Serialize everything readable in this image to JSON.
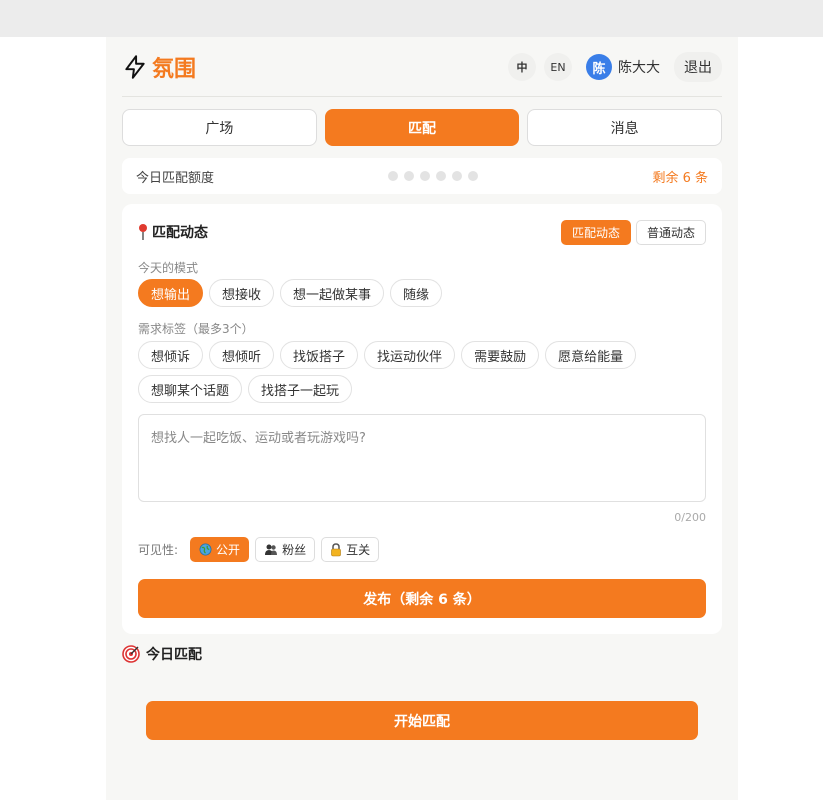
{
  "app": {
    "logo_text": "氛围",
    "lang_zh": "中",
    "lang_en": "EN",
    "avatar_initial": "陈",
    "username": "陈大大",
    "logout": "退出"
  },
  "tabs": [
    {
      "label": "广场"
    },
    {
      "label": "匹配"
    },
    {
      "label": "消息"
    }
  ],
  "quota": {
    "label": "今日匹配额度",
    "remaining": "剩余 6 条"
  },
  "post": {
    "title": "匹配动态",
    "type_match": "匹配动态",
    "type_normal": "普通动态",
    "mode_label": "今天的模式",
    "modes": [
      "想输出",
      "想接收",
      "想一起做某事",
      "随缘"
    ],
    "tags_label": "需求标签（最多3个）",
    "tags": [
      "想倾诉",
      "想倾听",
      "找饭搭子",
      "找运动伙伴",
      "需要鼓励",
      "愿意给能量",
      "想聊某个话题",
      "找搭子一起玩"
    ],
    "placeholder": "想找人一起吃饭、运动或者玩游戏吗?",
    "counter": "0/200",
    "visibility_label": "可见性:",
    "vis_public": "公开",
    "vis_fans": "粉丝",
    "vis_mutual": "互关",
    "publish": "发布（剩余 6 条）"
  },
  "today": {
    "title": "今日匹配",
    "start": "开始匹配"
  },
  "colors": {
    "accent": "#f47a1f",
    "avatar": "#3a7ee8"
  }
}
